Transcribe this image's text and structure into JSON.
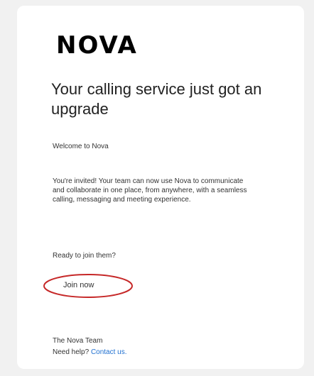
{
  "brand": {
    "logo_text": "NOVA"
  },
  "headline": "Your calling service just got an upgrade",
  "welcome": "Welcome to Nova",
  "body": "You're invited! Your team can now use Nova to communicate and collaborate in one place, from anywhere, with a seamless calling, messaging and meeting experience.",
  "ready": "Ready to join them?",
  "cta": {
    "label": "Join now",
    "annotation_color": "#c62828"
  },
  "footer": {
    "signature": "The Nova Team",
    "help_prefix": "Need help?",
    "contact_label": "Contact us."
  },
  "colors": {
    "link": "#1e6fd0",
    "background": "#f1f1f1",
    "card": "#ffffff"
  }
}
